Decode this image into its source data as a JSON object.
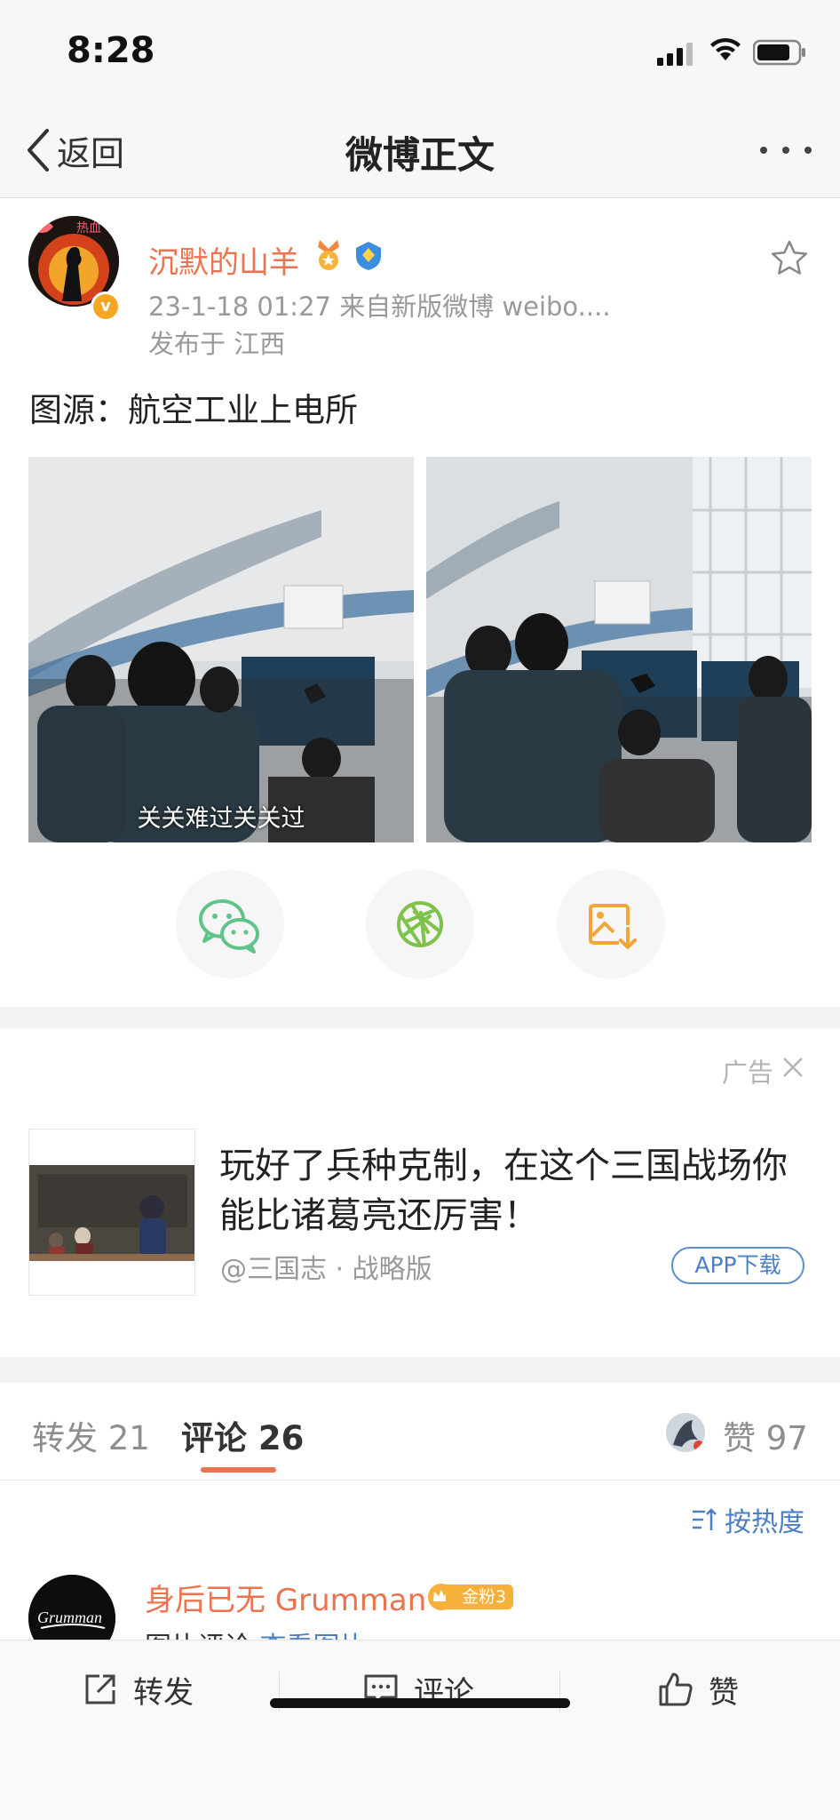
{
  "status_bar": {
    "time": "8:28"
  },
  "nav": {
    "back_label": "返回",
    "title": "微博正文"
  },
  "post": {
    "username": "沉默的山羊",
    "timestamp_source": "23-1-18 01:27  来自新版微博 weibo....",
    "location": "发布于 江西",
    "text": "图源：航空工业上电所",
    "image_caption": "关关难过关关过"
  },
  "ad": {
    "label": "广告",
    "title": "玩好了兵种克制，在这个三国战场你能比诸葛亮还厉害！",
    "source": "@三国志 · 战略版",
    "button": "APP下载"
  },
  "tabs": {
    "repost": "转发 21",
    "comment": "评论 26",
    "like": "赞 97"
  },
  "sort_label": "按热度",
  "comment": {
    "username": "身后已无 Grumman",
    "fan_badge": "金粉3",
    "text_prefix": "图片评论 ",
    "link_text": "查看图片"
  },
  "bottom_bar": {
    "repost": "转发",
    "comment": "评论",
    "like": "赞"
  },
  "colors": {
    "accent": "#eb7350",
    "link": "#4b7fc6",
    "wechat": "#62b900",
    "moments": "#7fc24b",
    "save": "#f0a63a"
  }
}
